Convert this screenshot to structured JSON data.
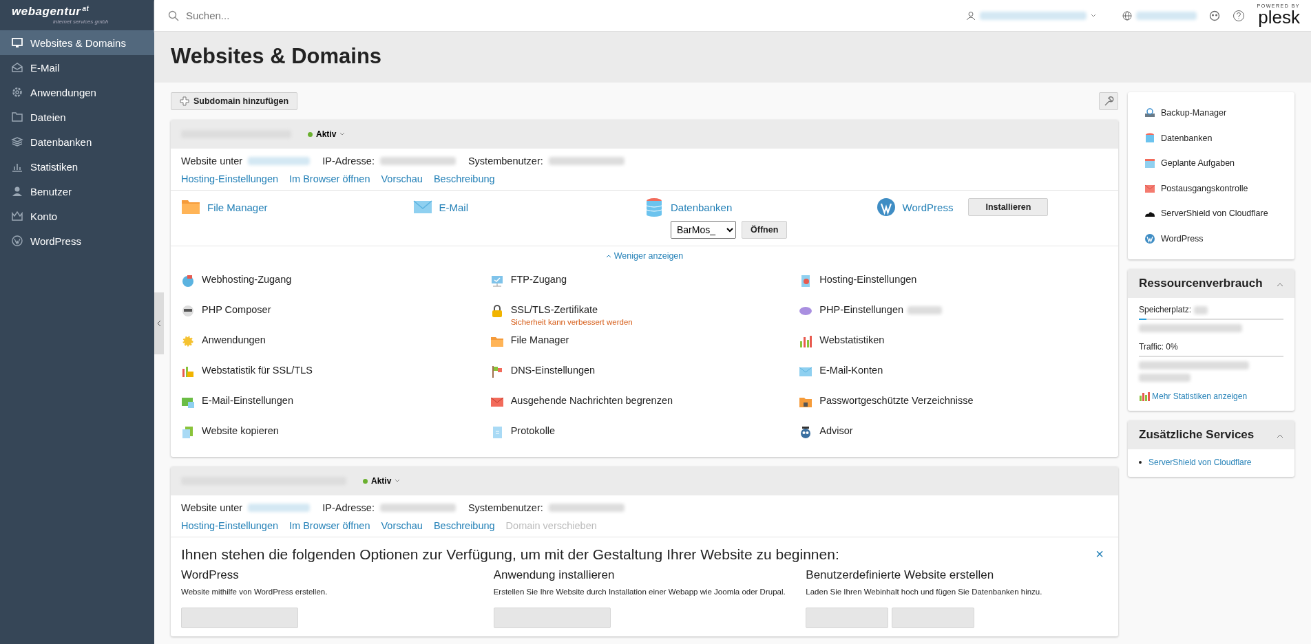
{
  "brand": {
    "name": "webagentur",
    "suffix": "at",
    "tagline": "internet services gmbh"
  },
  "sidebar": {
    "items": [
      {
        "label": "Websites & Domains",
        "selected": true
      },
      {
        "label": "E-Mail",
        "selected": false
      },
      {
        "label": "Anwendungen",
        "selected": false
      },
      {
        "label": "Dateien",
        "selected": false
      },
      {
        "label": "Datenbanken",
        "selected": false
      },
      {
        "label": "Statistiken",
        "selected": false
      },
      {
        "label": "Benutzer",
        "selected": false
      },
      {
        "label": "Konto",
        "selected": false
      },
      {
        "label": "WordPress",
        "selected": false
      }
    ]
  },
  "topbar": {
    "search": {
      "placeholder": "Suchen..."
    },
    "powered_by": "POWERED BY",
    "product": "plesk"
  },
  "page": {
    "title": "Websites & Domains",
    "add_button": "Subdomain hinzufügen"
  },
  "domains": [
    {
      "status": "Aktiv",
      "active": true,
      "info": [
        "Website unter",
        "IP-Adresse:",
        "Systembenutzer:"
      ],
      "links": [
        {
          "label": "Hosting-Einstellungen",
          "disabled": false
        },
        {
          "label": "Im Browser öffnen",
          "disabled": false
        },
        {
          "label": "Vorschau",
          "disabled": false
        },
        {
          "label": "Beschreibung",
          "disabled": false
        }
      ],
      "apps": [
        {
          "label": "File Manager"
        },
        {
          "label": "E-Mail"
        },
        {
          "label": "Datenbanken",
          "select": "BarMos_",
          "button": "Öffnen"
        },
        {
          "label": "WordPress",
          "button": "Installieren"
        }
      ],
      "toggle": {
        "label": "Weniger anzeigen",
        "expanded": true
      },
      "tools": [
        {
          "label": "Webhosting-Zugang"
        },
        {
          "label": "FTP-Zugang"
        },
        {
          "label": "Hosting-Einstellungen"
        },
        {
          "label": "PHP Composer"
        },
        {
          "label": "SSL/TLS-Zertifikate",
          "warning": "Sicherheit kann verbessert werden"
        },
        {
          "label": "PHP-Einstellungen",
          "blurred": true
        },
        {
          "label": "Anwendungen"
        },
        {
          "label": "File Manager"
        },
        {
          "label": "Webstatistiken"
        },
        {
          "label": "Webstatistik für SSL/TLS"
        },
        {
          "label": "DNS-Einstellungen"
        },
        {
          "label": "E-Mail-Konten"
        },
        {
          "label": "E-Mail-Einstellungen"
        },
        {
          "label": "Ausgehende Nachrichten begrenzen"
        },
        {
          "label": "Passwortgeschützte Verzeichnisse"
        },
        {
          "label": "Website kopieren"
        },
        {
          "label": "Protokolle"
        },
        {
          "label": "Advisor"
        }
      ]
    },
    {
      "status": "Aktiv",
      "active": true,
      "info": [
        "Website unter",
        "IP-Adresse:",
        "Systembenutzer:"
      ],
      "links": [
        {
          "label": "Hosting-Einstellungen",
          "disabled": false
        },
        {
          "label": "Im Browser öffnen",
          "disabled": false
        },
        {
          "label": "Vorschau",
          "disabled": false
        },
        {
          "label": "Beschreibung",
          "disabled": false
        },
        {
          "label": "Domain verschieben",
          "disabled": true
        }
      ],
      "options": {
        "heading": "Ihnen stehen die folgenden Optionen zur Verfügung, um mit der Gestaltung Ihrer Website zu beginnen:",
        "close": "×",
        "columns": [
          {
            "title": "WordPress",
            "text": "Website mithilfe von WordPress erstellen."
          },
          {
            "title": "Anwendung installieren",
            "text": "Erstellen Sie Ihre Website durch Installation einer Webapp wie Joomla oder Drupal."
          },
          {
            "title": "Benutzerdefinierte Website erstellen",
            "text": "Laden Sie Ihren Webinhalt hoch und fügen Sie Datenbanken hinzu."
          }
        ]
      }
    }
  ],
  "quick_links": [
    {
      "label": "Backup-Manager"
    },
    {
      "label": "Datenbanken"
    },
    {
      "label": "Geplante Aufgaben"
    },
    {
      "label": "Postausgangskontrolle"
    },
    {
      "label": "ServerShield von Cloudflare"
    },
    {
      "label": "WordPress"
    }
  ],
  "resources": {
    "title": "Ressourcenverbrauch",
    "expanded": true,
    "disk_label": "Speicherplatz:",
    "disk": {
      "level": 0.05
    },
    "traffic_label": "Traffic: 0%",
    "traffic": {
      "level": 0
    },
    "more": "Mehr Statistiken anzeigen"
  },
  "services": {
    "title": "Zusätzliche Services",
    "expanded": true,
    "items": [
      "ServerShield von Cloudflare"
    ]
  }
}
